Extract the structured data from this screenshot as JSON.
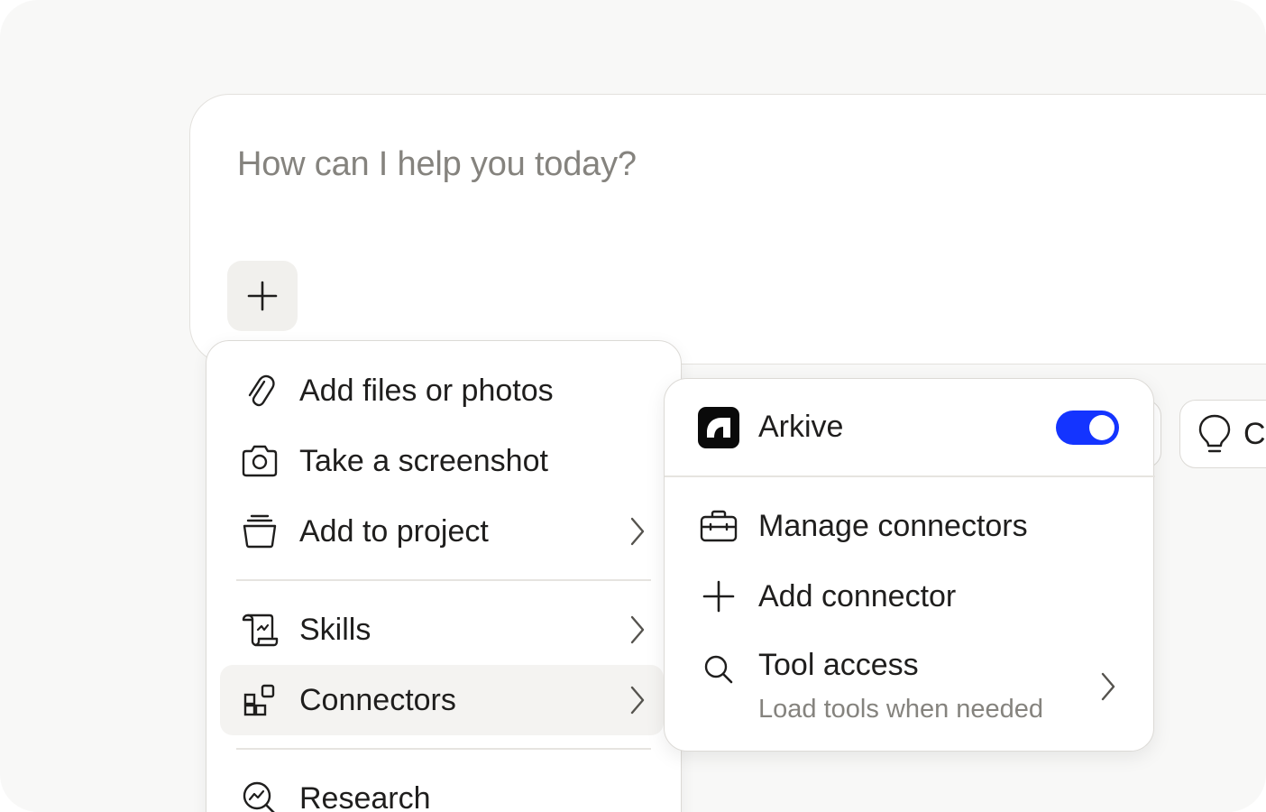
{
  "composer": {
    "placeholder": "How can I help you today?"
  },
  "chips": {
    "right_label": "C"
  },
  "menu": {
    "items": [
      {
        "label": "Add files or photos",
        "icon": "paperclip-icon",
        "has_submenu": false
      },
      {
        "label": "Take a screenshot",
        "icon": "camera-icon",
        "has_submenu": false
      },
      {
        "label": "Add to project",
        "icon": "project-stack-icon",
        "has_submenu": true
      },
      {
        "label": "Skills",
        "icon": "scroll-icon",
        "has_submenu": true
      },
      {
        "label": "Connectors",
        "icon": "connectors-icon",
        "has_submenu": true,
        "active": true
      },
      {
        "label": "Research",
        "icon": "research-icon",
        "has_submenu": false
      }
    ]
  },
  "submenu": {
    "connector": {
      "name": "Arkive",
      "enabled": true
    },
    "manage": "Manage connectors",
    "add": "Add connector",
    "tool_access": {
      "label": "Tool access",
      "description": "Load tools when needed"
    }
  },
  "colors": {
    "toggle_on": "#1434ff",
    "muted_text": "#85837e",
    "hover_bg": "#f4f3f1"
  }
}
